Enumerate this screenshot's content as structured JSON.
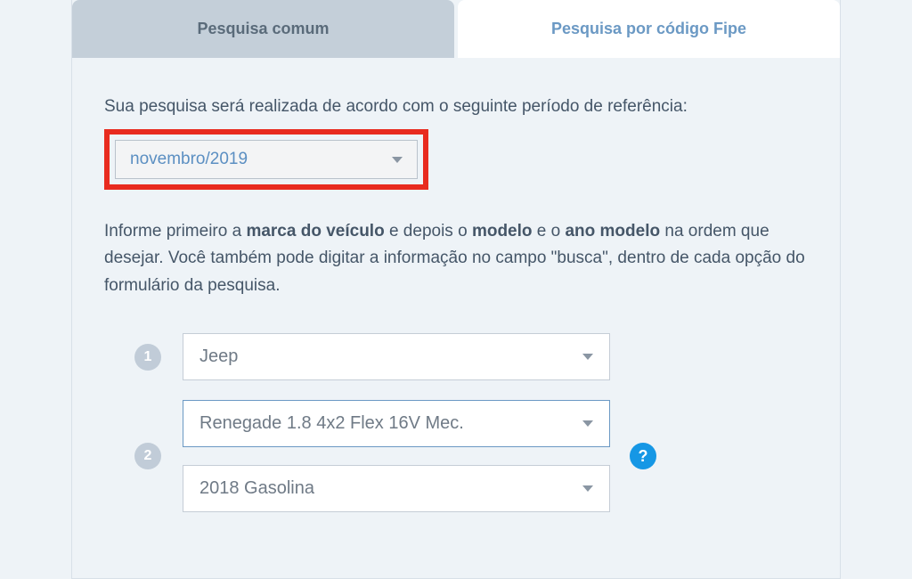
{
  "tabs": {
    "common": "Pesquisa comum",
    "fipe": "Pesquisa por código Fipe"
  },
  "period": {
    "label": "Sua pesquisa será realizada de acordo com o seguinte período de referência:",
    "value": "novembro/2019"
  },
  "instructions": {
    "part1": "Informe primeiro a ",
    "bold1": "marca do veículo",
    "part2": " e depois o ",
    "bold2": "modelo",
    "part3": " e o ",
    "bold3": "ano modelo",
    "part4": " na ordem que desejar. Você também pode digitar a informação no campo \"busca\", dentro de cada opção do formulário da pesquisa."
  },
  "steps": {
    "one": "1",
    "two": "2"
  },
  "selects": {
    "brand": "Jeep",
    "model": "Renegade 1.8 4x2 Flex 16V Mec.",
    "year": "2018 Gasolina"
  },
  "help": "?"
}
